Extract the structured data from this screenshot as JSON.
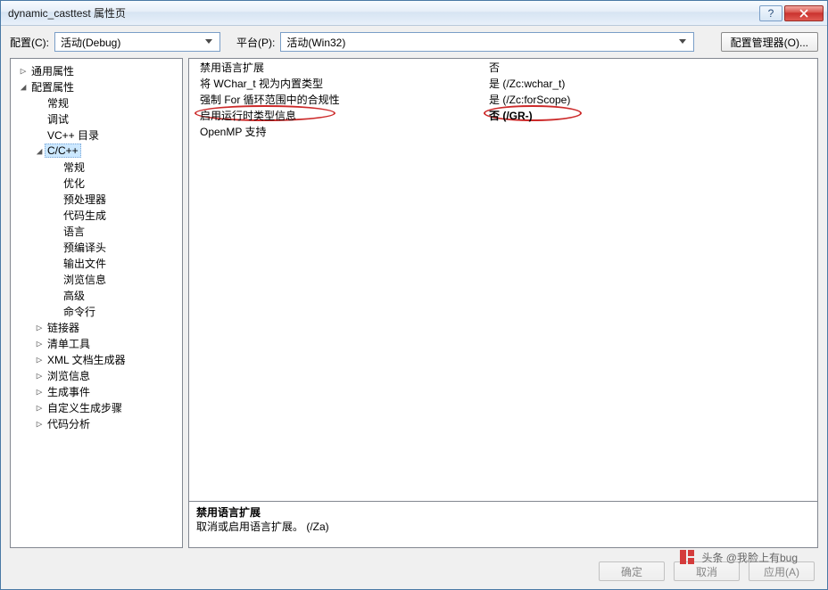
{
  "window": {
    "title": "dynamic_casttest 属性页"
  },
  "toolbar": {
    "config_label": "配置(C):",
    "config_value": "活动(Debug)",
    "platform_label": "平台(P):",
    "platform_value": "活动(Win32)",
    "manager_label": "配置管理器(O)..."
  },
  "tree": [
    {
      "indent": 0,
      "expander": "▷",
      "label": "通用属性"
    },
    {
      "indent": 0,
      "expander": "◢",
      "label": "配置属性"
    },
    {
      "indent": 1,
      "expander": "",
      "label": "常规"
    },
    {
      "indent": 1,
      "expander": "",
      "label": "调试"
    },
    {
      "indent": 1,
      "expander": "",
      "label": "VC++ 目录"
    },
    {
      "indent": 1,
      "expander": "◢",
      "label": "C/C++",
      "selected": true
    },
    {
      "indent": 2,
      "expander": "",
      "label": "常规"
    },
    {
      "indent": 2,
      "expander": "",
      "label": "优化"
    },
    {
      "indent": 2,
      "expander": "",
      "label": "预处理器"
    },
    {
      "indent": 2,
      "expander": "",
      "label": "代码生成"
    },
    {
      "indent": 2,
      "expander": "",
      "label": "语言"
    },
    {
      "indent": 2,
      "expander": "",
      "label": "预编译头"
    },
    {
      "indent": 2,
      "expander": "",
      "label": "输出文件"
    },
    {
      "indent": 2,
      "expander": "",
      "label": "浏览信息"
    },
    {
      "indent": 2,
      "expander": "",
      "label": "高级"
    },
    {
      "indent": 2,
      "expander": "",
      "label": "命令行"
    },
    {
      "indent": 1,
      "expander": "▷",
      "label": "链接器"
    },
    {
      "indent": 1,
      "expander": "▷",
      "label": "清单工具"
    },
    {
      "indent": 1,
      "expander": "▷",
      "label": "XML 文档生成器"
    },
    {
      "indent": 1,
      "expander": "▷",
      "label": "浏览信息"
    },
    {
      "indent": 1,
      "expander": "▷",
      "label": "生成事件"
    },
    {
      "indent": 1,
      "expander": "▷",
      "label": "自定义生成步骤"
    },
    {
      "indent": 1,
      "expander": "▷",
      "label": "代码分析"
    }
  ],
  "grid": [
    {
      "name": "禁用语言扩展",
      "value": "否"
    },
    {
      "name": "将 WChar_t 视为内置类型",
      "value": "是 (/Zc:wchar_t)"
    },
    {
      "name": "强制 For 循环范围中的合规性",
      "value": "是 (/Zc:forScope)"
    },
    {
      "name": "启用运行时类型信息",
      "value": "否 (/GR-)",
      "highlight": true
    },
    {
      "name": "OpenMP 支持",
      "value": ""
    }
  ],
  "description": {
    "title": "禁用语言扩展",
    "body": "取消或启用语言扩展。     (/Za)"
  },
  "footer": {
    "ok": "确定",
    "cancel": "取消",
    "apply": "应用(A)"
  },
  "watermark": "头条 @我脸上有bug"
}
